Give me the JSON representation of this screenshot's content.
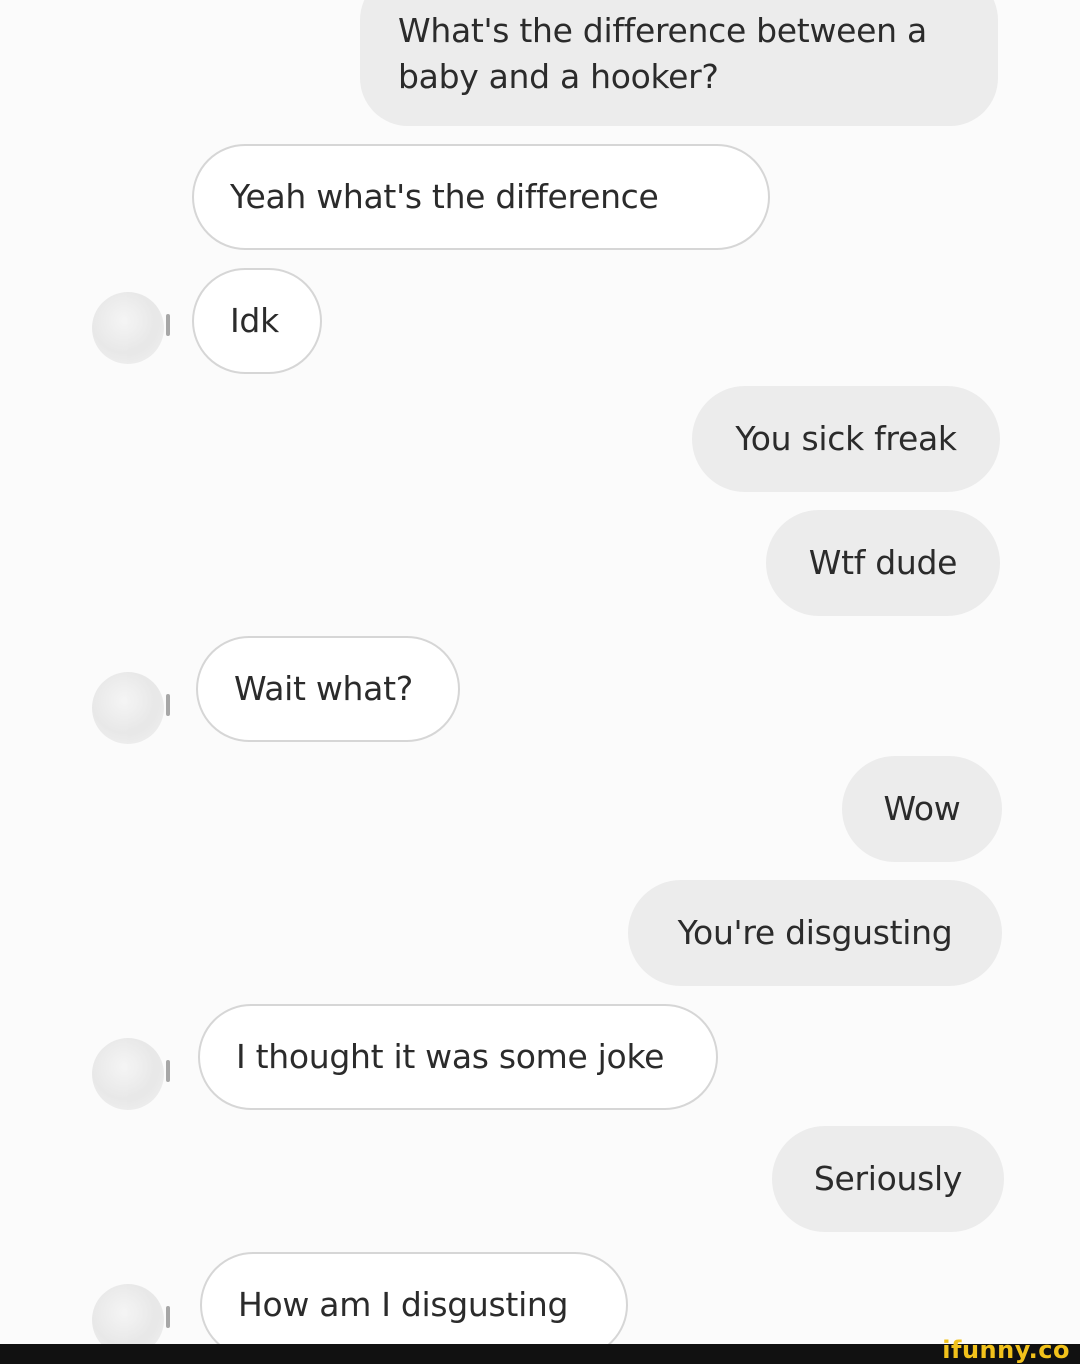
{
  "messages": [
    {
      "id": "m1",
      "side": "out",
      "text": "What's the difference between a baby and a hooker?"
    },
    {
      "id": "m2",
      "side": "in",
      "text": "Yeah what's the difference"
    },
    {
      "id": "m3",
      "side": "in",
      "text": "Idk"
    },
    {
      "id": "m4",
      "side": "out",
      "text": "You sick freak"
    },
    {
      "id": "m5",
      "side": "out",
      "text": "Wtf dude"
    },
    {
      "id": "m6",
      "side": "in",
      "text": "Wait what?"
    },
    {
      "id": "m7",
      "side": "out",
      "text": "Wow"
    },
    {
      "id": "m8",
      "side": "out",
      "text": "You're disgusting"
    },
    {
      "id": "m9",
      "side": "in",
      "text": "I thought it was some joke"
    },
    {
      "id": "m10",
      "side": "out",
      "text": "Seriously"
    },
    {
      "id": "m11",
      "side": "in",
      "text": "How am I disgusting"
    }
  ],
  "watermark": {
    "text": "ifunny.co",
    "color": "#f2c21b"
  },
  "colors": {
    "outgoing_bubble": "#ececec",
    "incoming_bubble": "#ffffff",
    "incoming_border": "#d6d6d6"
  }
}
